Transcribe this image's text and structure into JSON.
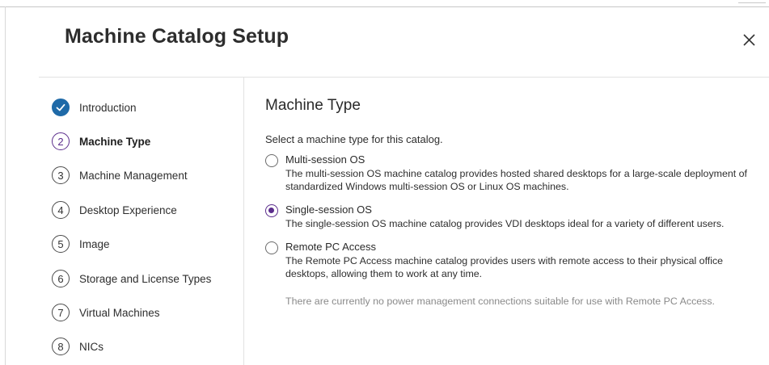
{
  "dialog": {
    "title": "Machine Catalog Setup",
    "close_icon": "close-icon"
  },
  "steps": [
    {
      "number": "",
      "label": "Introduction",
      "state": "completed",
      "icon": "checkmark-icon"
    },
    {
      "number": "2",
      "label": "Machine Type",
      "state": "current"
    },
    {
      "number": "3",
      "label": "Machine Management",
      "state": "pending"
    },
    {
      "number": "4",
      "label": "Desktop Experience",
      "state": "pending"
    },
    {
      "number": "5",
      "label": "Image",
      "state": "pending"
    },
    {
      "number": "6",
      "label": "Storage and License Types",
      "state": "pending"
    },
    {
      "number": "7",
      "label": "Virtual Machines",
      "state": "pending"
    },
    {
      "number": "8",
      "label": "NICs",
      "state": "pending"
    }
  ],
  "main": {
    "section_title": "Machine Type",
    "instruction": "Select a machine type for this catalog.",
    "options": [
      {
        "title": "Multi-session OS",
        "description": "The multi-session OS machine catalog provides hosted shared desktops for a large-scale deployment of standardized Windows multi-session OS or Linux OS machines.",
        "selected": false
      },
      {
        "title": "Single-session OS",
        "description": "The single-session OS machine catalog provides VDI desktops ideal for a variety of different users.",
        "selected": true
      },
      {
        "title": "Remote PC Access",
        "description": "The Remote PC Access machine catalog provides users with remote access to their physical office desktops, allowing them to work at any time.",
        "note": "There are currently no power management connections suitable for use with Remote PC Access.",
        "selected": false
      }
    ]
  },
  "colors": {
    "accent": "#5b2d8c",
    "completed": "#1f6aa8",
    "muted_text": "#8a8a8a"
  }
}
